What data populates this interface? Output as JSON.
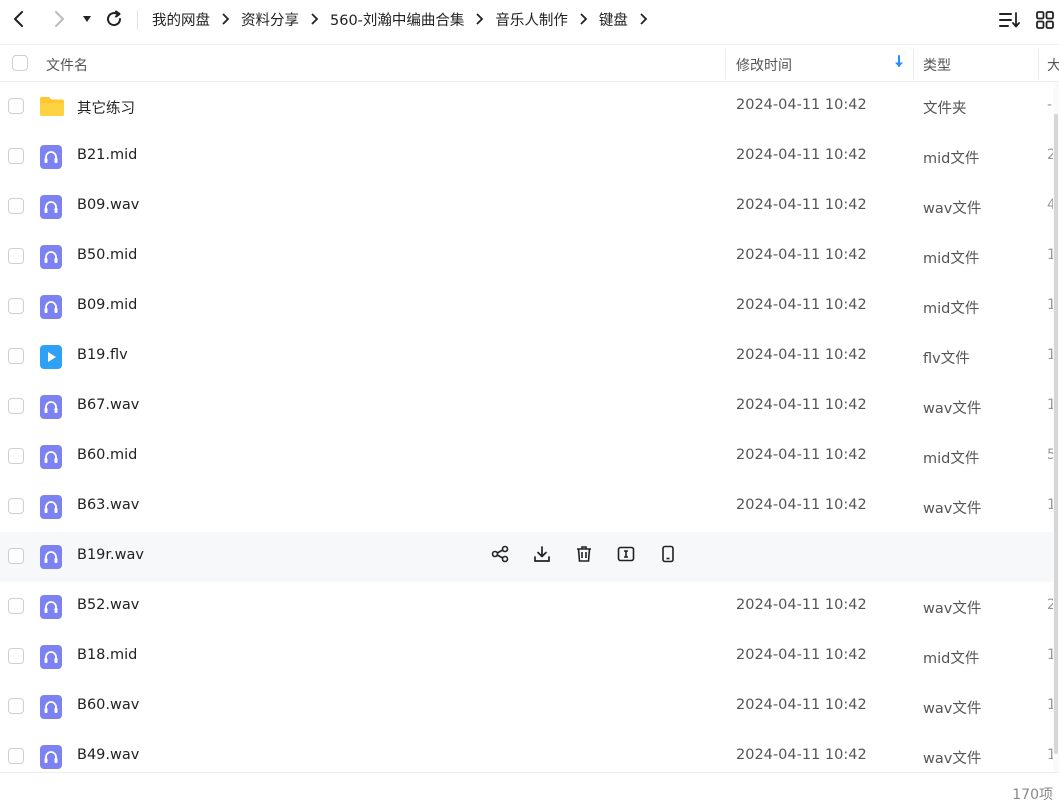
{
  "nav": {
    "back_icon": "chevron-left-icon",
    "forward_icon": "chevron-right-icon",
    "history_icon": "caret-down-icon",
    "refresh_icon": "refresh-icon",
    "sort_icon": "sort-list-icon",
    "view_icon": "grid-view-icon"
  },
  "breadcrumb": [
    "我的网盘",
    "资料分享",
    "560-刘瀚中编曲合集",
    "音乐人制作",
    "键盘"
  ],
  "table": {
    "headers": {
      "name": "文件名",
      "mtime": "修改时间",
      "type": "类型",
      "size": "大"
    },
    "sort_indicator_color": "#1e90ff"
  },
  "colors": {
    "audio_icon": "#7c82f2",
    "video_icon": "#2ea0f5",
    "folder_icon": "#ffc833"
  },
  "rows": [
    {
      "name": "其它练习",
      "mtime": "2024-04-11 10:42",
      "type": "文件夹",
      "size": "-",
      "icon": "folder-icon"
    },
    {
      "name": "B21.mid",
      "mtime": "2024-04-11 10:42",
      "type": "mid文件",
      "size": "2",
      "icon": "audio-icon"
    },
    {
      "name": "B09.wav",
      "mtime": "2024-04-11 10:42",
      "type": "wav文件",
      "size": "4",
      "icon": "audio-icon"
    },
    {
      "name": "B50.mid",
      "mtime": "2024-04-11 10:42",
      "type": "mid文件",
      "size": "1",
      "icon": "audio-icon"
    },
    {
      "name": "B09.mid",
      "mtime": "2024-04-11 10:42",
      "type": "mid文件",
      "size": "1",
      "icon": "audio-icon"
    },
    {
      "name": "B19.flv",
      "mtime": "2024-04-11 10:42",
      "type": "flv文件",
      "size": "1",
      "icon": "video-icon"
    },
    {
      "name": "B67.wav",
      "mtime": "2024-04-11 10:42",
      "type": "wav文件",
      "size": "1",
      "icon": "audio-icon"
    },
    {
      "name": "B60.mid",
      "mtime": "2024-04-11 10:42",
      "type": "mid文件",
      "size": "5",
      "icon": "audio-icon"
    },
    {
      "name": "B63.wav",
      "mtime": "2024-04-11 10:42",
      "type": "wav文件",
      "size": "1",
      "icon": "audio-icon"
    },
    {
      "name": "B19r.wav",
      "mtime": "",
      "type": "",
      "size": "",
      "icon": "audio-icon",
      "hover": true,
      "actions": [
        "share-icon",
        "download-icon",
        "delete-icon",
        "rename-icon",
        "send-to-phone-icon"
      ]
    },
    {
      "name": "B52.wav",
      "mtime": "2024-04-11 10:42",
      "type": "wav文件",
      "size": "2",
      "icon": "audio-icon"
    },
    {
      "name": "B18.mid",
      "mtime": "2024-04-11 10:42",
      "type": "mid文件",
      "size": "1",
      "icon": "audio-icon"
    },
    {
      "name": "B60.wav",
      "mtime": "2024-04-11 10:42",
      "type": "wav文件",
      "size": "1",
      "icon": "audio-icon"
    },
    {
      "name": "B49.wav",
      "mtime": "2024-04-11 10:42",
      "type": "wav文件",
      "size": "1",
      "icon": "audio-icon"
    }
  ],
  "footer": {
    "count": "170项"
  }
}
